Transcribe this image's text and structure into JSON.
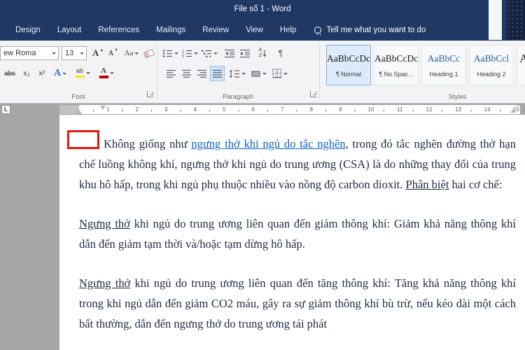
{
  "window": {
    "title": "File số 1 - Word"
  },
  "ribbon": {
    "tabs": [
      "Design",
      "Layout",
      "References",
      "Mailings",
      "Review",
      "View",
      "Help"
    ],
    "tell_me_label": "Tell me what you want to do",
    "font_group": {
      "label": "Font",
      "font_name_value": "ew Roma",
      "font_size_value": "13",
      "grow_font": "A",
      "shrink_font": "A",
      "change_case": "Aa",
      "strikethrough": "abc",
      "subscript": "x₂",
      "superscript": "x²",
      "text_effects": "A",
      "highlight": "ab",
      "font_color": "A"
    },
    "paragraph_group": {
      "label": "Paragraph",
      "sort_a": "A",
      "sort_z": "Z",
      "pilcrow": "¶"
    },
    "styles_group": {
      "label": "Styles",
      "items": [
        {
          "preview": "AaBbCcDc",
          "name": "¶ Normal"
        },
        {
          "preview": "AaBbCcDc",
          "name": "¶ No Spac..."
        },
        {
          "preview": "AaBbCc",
          "name": "Heading 1"
        },
        {
          "preview": "AaBbCcl",
          "name": "Heading 2"
        },
        {
          "preview": "A",
          "name": ""
        }
      ]
    }
  },
  "ruler": {
    "tab_selector": "L",
    "numbers": [
      "1",
      "2",
      "3",
      "4",
      "5",
      "6",
      "7",
      "8",
      "9",
      "10",
      "11",
      "12",
      "13",
      "14",
      "15"
    ]
  },
  "document": {
    "paragraphs": [
      {
        "indent": true,
        "runs": [
          {
            "text": "Không giống như ",
            "style": ""
          },
          {
            "text": "ngưng thở khi ngủ do tắc nghẽn",
            "style": "hyperlink"
          },
          {
            "text": ", trong đó tắc nghẽn đường thở hạn chế luồng không khí, ngưng thở khi ngủ do trung ương (CSA) là do những thay đổi của trung khu hô hấp, trong khi ngủ phụ thuộc nhiều vào nồng độ carbon dioxit. ",
            "style": ""
          },
          {
            "text": "Phân biệt",
            "style": "underline"
          },
          {
            "text": " hai cơ chế:",
            "style": ""
          }
        ]
      },
      {
        "indent": false,
        "runs": [
          {
            "text": "Ngưng thở",
            "style": "underline"
          },
          {
            "text": " khi ngủ do trung ương liên quan đến giảm thông khí: Giảm khả năng thông khí dẫn đến giảm tạm thời và/hoặc tạm dừng hô hấp.",
            "style": ""
          }
        ]
      },
      {
        "indent": false,
        "runs": [
          {
            "text": "Ngưng thở",
            "style": "underline"
          },
          {
            "text": " khi ngủ do trung ương liên quan đến tăng thông khí: Tăng khả năng thông khí trong khi ngủ dẫn đến giảm CO2 máu, gây ra sự giảm thông khí bù trừ, nếu kéo dài một cách bất thường, dẫn đến ngưng thở do trung ương tái phát",
            "style": ""
          }
        ]
      }
    ]
  },
  "colors": {
    "titlebar": "#1f3864",
    "hyperlink": "#0b61c9",
    "body_text": "#1f2a44",
    "heading_preview": "#2e5b97",
    "annotation": "#e8150d"
  }
}
